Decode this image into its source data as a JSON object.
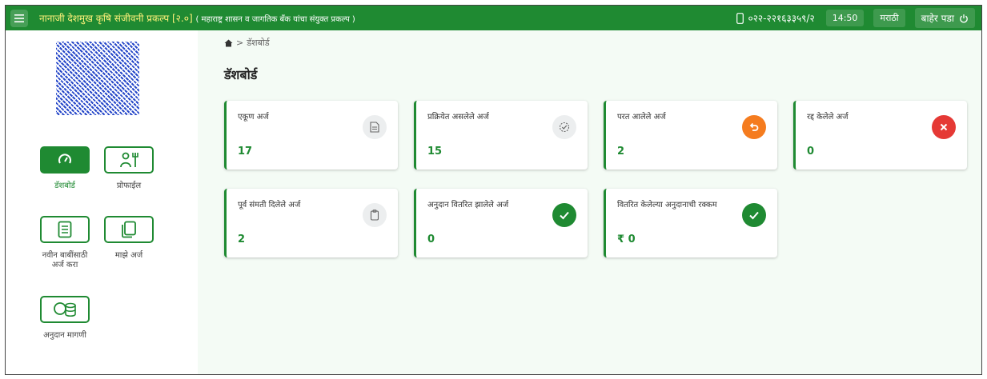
{
  "header": {
    "title": "नानाजी देशमुख कृषि संजीवनी प्रकल्प [२.०]",
    "subtitle": "( महाराष्ट्र शासन व जागतिक बँक यांचा संयुक्त प्रकल्प )",
    "phone": "०२२-२२१६३३५९/२",
    "time": "14:50",
    "language": "मराठी",
    "logout_label": "बाहेर पडा"
  },
  "sidebar": {
    "items": [
      {
        "label": "डॅशबोर्ड",
        "icon": "speedometer-icon",
        "active": true
      },
      {
        "label": "प्रोफाईल",
        "icon": "farmer-profile-icon",
        "active": false
      },
      {
        "label": "नवीन बाबींसाठी अर्ज करा",
        "icon": "checklist-icon",
        "active": false
      },
      {
        "label": "माझे अर्ज",
        "icon": "documents-icon",
        "active": false
      },
      {
        "label": "अनुदान मागणी",
        "icon": "coins-icon",
        "active": false
      }
    ]
  },
  "breadcrumb": {
    "current": "डॅशबोर्ड"
  },
  "page_title": "डॅशबोर्ड",
  "cards": [
    {
      "label": "एकूण अर्ज",
      "value": "17",
      "icon": "document-icon",
      "icon_color": "#eceeef"
    },
    {
      "label": "प्रक्रियेत असलेले अर्ज",
      "value": "15",
      "icon": "in-progress-icon",
      "icon_color": "#eceeef"
    },
    {
      "label": "परत आलेले अर्ज",
      "value": "2",
      "icon": "return-icon",
      "icon_color": "#f57c1f"
    },
    {
      "label": "रद्द केलेले अर्ज",
      "value": "0",
      "icon": "cancel-icon",
      "icon_color": "#e53935"
    },
    {
      "label": "पूर्व संमती दिलेले अर्ज",
      "value": "2",
      "icon": "clipboard-icon",
      "icon_color": "#eceeef"
    },
    {
      "label": "अनुदान वितरित झालेले अर्ज",
      "value": "0",
      "icon": "check-icon",
      "icon_color": "#1f8a32"
    },
    {
      "label": "वितरित केलेल्या अनुदानाची रक्कम",
      "value": "₹ 0",
      "icon": "check-icon",
      "icon_color": "#1f8a32"
    }
  ],
  "colors": {
    "brand_green": "#1f8a32",
    "title_yellow": "#fff27a",
    "background": "#f4fbf5"
  }
}
